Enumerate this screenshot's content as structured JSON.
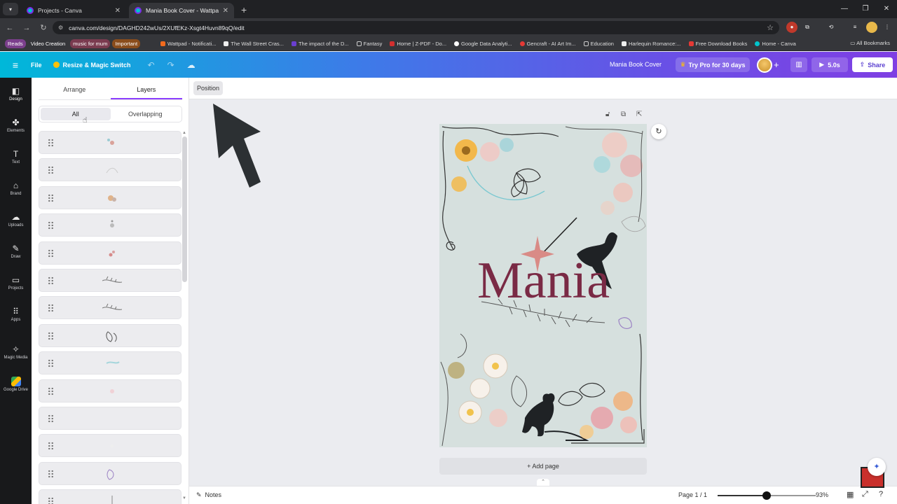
{
  "browser": {
    "tabs": [
      {
        "label": "Projects - Canva",
        "active": false
      },
      {
        "label": "Mania Book Cover - Wattpad B...",
        "active": true
      }
    ],
    "url": "canva.com/design/DAGHD242wUs/2XUfEKz-Xsgt4Huvn89qQ/edit",
    "bookmarks": [
      {
        "label": "Reads",
        "pill": true
      },
      {
        "label": "Video Creation",
        "pill": true
      },
      {
        "label": "music for mum",
        "pill": true
      },
      {
        "label": "Important",
        "pill": true
      },
      {
        "label": "Wattpad - Notificati...",
        "pill": false
      },
      {
        "label": "The Wall Street Cras...",
        "pill": false
      },
      {
        "label": "The impact of the D...",
        "pill": false
      },
      {
        "label": "Fantasy",
        "pill": false
      },
      {
        "label": "Home | Z-PDF - Do...",
        "pill": false
      },
      {
        "label": "Google Data Analyti...",
        "pill": false
      },
      {
        "label": "Gencraft - AI Art Im...",
        "pill": false
      },
      {
        "label": "Education",
        "pill": false
      },
      {
        "label": "Harlequin Romance:...",
        "pill": false
      },
      {
        "label": "Free Download Books",
        "pill": false
      },
      {
        "label": "Home - Canva",
        "pill": false
      }
    ],
    "all_bookmarks": "All Bookmarks"
  },
  "header": {
    "file": "File",
    "resize": "Resize & Magic Switch",
    "design_title": "Mania Book Cover",
    "try_pro": "Try Pro for 30 days",
    "play_duration": "5.0s",
    "share": "Share"
  },
  "rail": [
    {
      "label": "Design",
      "icon": "design-icon",
      "glyph": "◧"
    },
    {
      "label": "Elements",
      "icon": "elements-icon",
      "glyph": "✤"
    },
    {
      "label": "Text",
      "icon": "text-icon",
      "glyph": "T"
    },
    {
      "label": "Brand",
      "icon": "brand-icon",
      "glyph": "⌂"
    },
    {
      "label": "Uploads",
      "icon": "uploads-icon",
      "glyph": "☁"
    },
    {
      "label": "Draw",
      "icon": "draw-icon",
      "glyph": "✎"
    },
    {
      "label": "Projects",
      "icon": "projects-icon",
      "glyph": "▭"
    },
    {
      "label": "Apps",
      "icon": "apps-icon",
      "glyph": "⠿"
    },
    {
      "label": "Magic Media",
      "icon": "magic-media-icon",
      "glyph": "✧"
    },
    {
      "label": "Google Drive",
      "icon": "google-drive-icon",
      "glyph": ""
    }
  ],
  "panel": {
    "tabs": [
      "Arrange",
      "Layers"
    ],
    "active_tab": "Layers",
    "filters": [
      "All",
      "Overlapping"
    ],
    "active_filter": "All",
    "layers_count": 14
  },
  "canvas": {
    "position_button": "Position",
    "add_page": "+ Add page",
    "cover_title": "Mania"
  },
  "footer": {
    "notes": "Notes",
    "page_counter": "Page 1 / 1",
    "zoom": "93%",
    "zoom_fraction": 0.5
  },
  "colors": {
    "accent": "#8b3dff",
    "title": "#7a2a45",
    "cover_bg": "#d6e0de"
  }
}
